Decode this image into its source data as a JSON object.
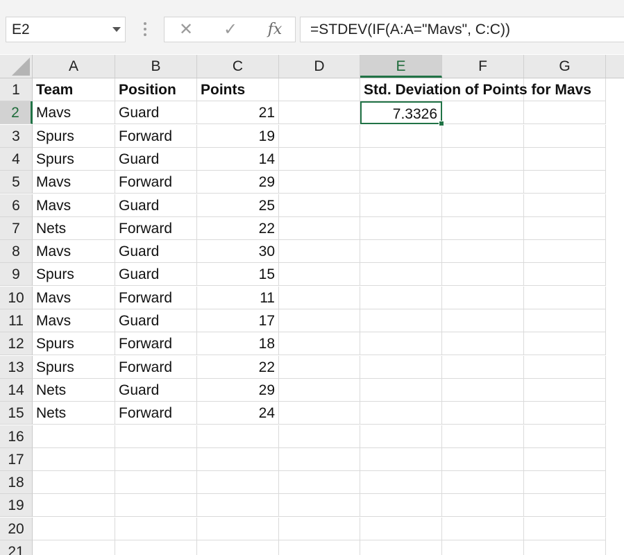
{
  "name_box": {
    "value": "E2"
  },
  "formula_bar": {
    "cancel_glyph": "✕",
    "enter_glyph": "✓",
    "insert_function_label": "fx",
    "formula": "=STDEV(IF(A:A=\"Mavs\", C:C))"
  },
  "columns": [
    "A",
    "B",
    "C",
    "D",
    "E",
    "F",
    "G"
  ],
  "selected_column": "E",
  "selected_row": 2,
  "rows": [
    {
      "num": "1",
      "A": "Team",
      "B": "Position",
      "C": "Points",
      "D": "",
      "E": "Std. Deviation of Points for Mavs"
    },
    {
      "num": "2",
      "A": "Mavs",
      "B": "Guard",
      "C": "21",
      "D": "",
      "E": "7.3326"
    },
    {
      "num": "3",
      "A": "Spurs",
      "B": "Forward",
      "C": "19",
      "D": "",
      "E": ""
    },
    {
      "num": "4",
      "A": "Spurs",
      "B": "Guard",
      "C": "14",
      "D": "",
      "E": ""
    },
    {
      "num": "5",
      "A": "Mavs",
      "B": "Forward",
      "C": "29",
      "D": "",
      "E": ""
    },
    {
      "num": "6",
      "A": "Mavs",
      "B": "Guard",
      "C": "25",
      "D": "",
      "E": ""
    },
    {
      "num": "7",
      "A": "Nets",
      "B": "Forward",
      "C": "22",
      "D": "",
      "E": ""
    },
    {
      "num": "8",
      "A": "Mavs",
      "B": "Guard",
      "C": "30",
      "D": "",
      "E": ""
    },
    {
      "num": "9",
      "A": "Spurs",
      "B": "Guard",
      "C": "15",
      "D": "",
      "E": ""
    },
    {
      "num": "10",
      "A": "Mavs",
      "B": "Forward",
      "C": "11",
      "D": "",
      "E": ""
    },
    {
      "num": "11",
      "A": "Mavs",
      "B": "Guard",
      "C": "17",
      "D": "",
      "E": ""
    },
    {
      "num": "12",
      "A": "Spurs",
      "B": "Forward",
      "C": "18",
      "D": "",
      "E": ""
    },
    {
      "num": "13",
      "A": "Spurs",
      "B": "Forward",
      "C": "22",
      "D": "",
      "E": ""
    },
    {
      "num": "14",
      "A": "Nets",
      "B": "Guard",
      "C": "29",
      "D": "",
      "E": ""
    },
    {
      "num": "15",
      "A": "Nets",
      "B": "Forward",
      "C": "24",
      "D": "",
      "E": ""
    },
    {
      "num": "16",
      "A": "",
      "B": "",
      "C": "",
      "D": "",
      "E": ""
    },
    {
      "num": "17",
      "A": "",
      "B": "",
      "C": "",
      "D": "",
      "E": ""
    },
    {
      "num": "18",
      "A": "",
      "B": "",
      "C": "",
      "D": "",
      "E": ""
    },
    {
      "num": "19",
      "A": "",
      "B": "",
      "C": "",
      "D": "",
      "E": ""
    },
    {
      "num": "20",
      "A": "",
      "B": "",
      "C": "",
      "D": "",
      "E": ""
    },
    {
      "num": "21",
      "A": "",
      "B": "",
      "C": "",
      "D": "",
      "E": ""
    }
  ],
  "colors": {
    "accent": "#217346",
    "header_bg": "#e9e9e9",
    "header_selected_bg": "#d2d2d2"
  }
}
